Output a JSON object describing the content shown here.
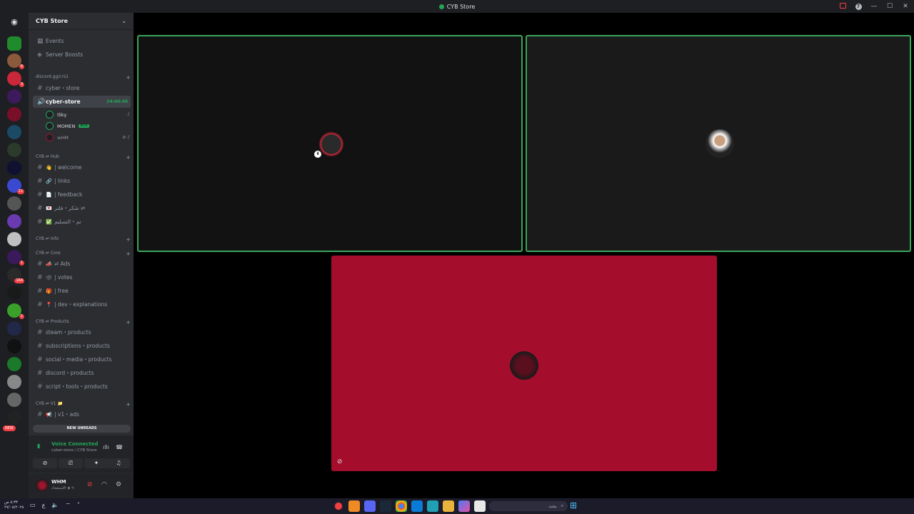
{
  "window": {
    "title": "CYB Store"
  },
  "rail": {
    "home_icon": "discord-logo-icon",
    "new_badge": "NEW",
    "badges": [
      "6",
      "3",
      "12",
      "1",
      "1",
      "164",
      "1"
    ]
  },
  "sidebar": {
    "server_name": "CYB Store",
    "top_items": [
      {
        "icon": "calendar-icon",
        "label": "Events"
      },
      {
        "icon": "boost-icon",
        "label": "Server Boosts"
      }
    ],
    "categories": {
      "invite": "discord.gg/crs1",
      "hub": "CYB ⇌ Hub",
      "info": "CYB ⇌ Info",
      "core": "CYB ⇌ Core",
      "products": "CYB ⇌ Products",
      "v1": "CYB ⇌ V1 📁"
    },
    "channels": {
      "cyber_store_text": "cyber・store",
      "voice_active": "cyber-store",
      "voice_timer": "24:40:48",
      "welcome": "| welcome",
      "links": "| links",
      "feedback": "| feedback",
      "shukr": "شكر・فلتر ⇌",
      "taslim": "تم・التسليم",
      "ads": "⇌ Ads",
      "votes": "| votes",
      "free": "| free",
      "dev": "| dev・explanations",
      "steam": "steam・products",
      "subs": "subscriptions・products",
      "social": "social・media・products",
      "discord": "discord・products",
      "script": "script・tools・products",
      "v1ads": "| v1・ads"
    },
    "voice_users": [
      {
        "name": "iSky"
      },
      {
        "name": "MOMEN",
        "tag": "KICK"
      },
      {
        "name": "wHM"
      }
    ],
    "new_unreads": "NEW UNREADS",
    "voice": {
      "status": "Voice Connected",
      "location": "cyber-store / CYB Store"
    },
    "user": {
      "name": "WHM",
      "status": "٩ ◈ الاستعداد"
    }
  },
  "taskbar": {
    "time": "٥:٣٣ ص",
    "date": "٢٧/٠٥/٢٠٢٥",
    "search_placeholder": "بحث"
  },
  "colors": {
    "speaking_border": "#3ba55c",
    "red_tile": "#a50d2d",
    "online": "#23a55a"
  }
}
